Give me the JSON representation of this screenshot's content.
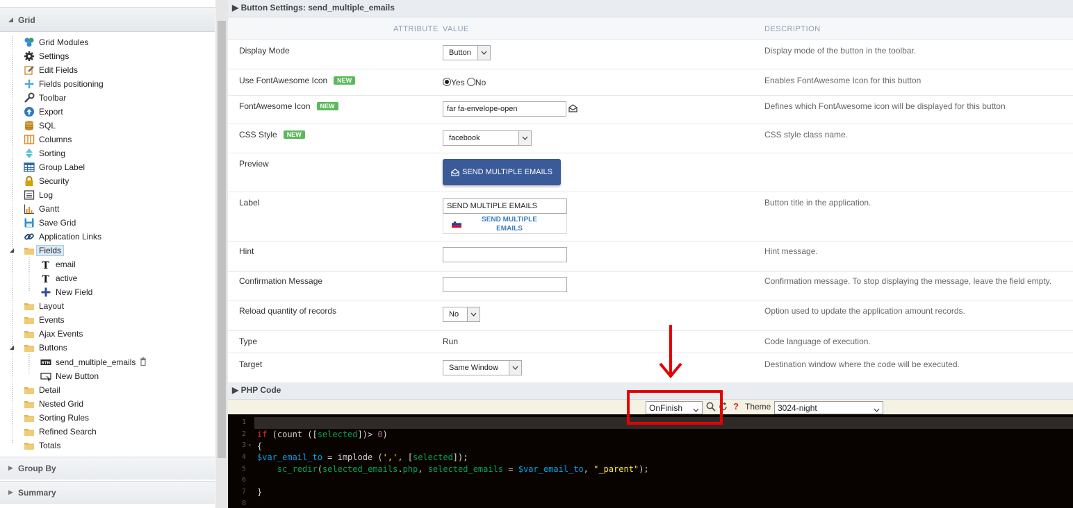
{
  "sidebar": {
    "header": "Grid",
    "items": [
      {
        "label": "Grid Modules",
        "icon": "modules-icon"
      },
      {
        "label": "Settings",
        "icon": "gear-icon"
      },
      {
        "label": "Edit Fields",
        "icon": "edit-icon"
      },
      {
        "label": "Fields positioning",
        "icon": "move-icon"
      },
      {
        "label": "Toolbar",
        "icon": "wrench-icon"
      },
      {
        "label": "Export",
        "icon": "export-icon"
      },
      {
        "label": "SQL",
        "icon": "database-icon"
      },
      {
        "label": "Columns",
        "icon": "columns-icon"
      },
      {
        "label": "Sorting",
        "icon": "sort-icon"
      },
      {
        "label": "Group Label",
        "icon": "table-icon"
      },
      {
        "label": "Security",
        "icon": "lock-icon"
      },
      {
        "label": "Log",
        "icon": "log-icon"
      },
      {
        "label": "Gantt",
        "icon": "chart-icon"
      },
      {
        "label": "Save Grid",
        "icon": "save-icon"
      },
      {
        "label": "Application Links",
        "icon": "link-icon"
      },
      {
        "label": "Fields",
        "icon": "folder-icon"
      },
      {
        "label": "email",
        "icon": "text-field-icon"
      },
      {
        "label": "active",
        "icon": "text-field-icon"
      },
      {
        "label": "New Field",
        "icon": "plus-icon"
      },
      {
        "label": "Layout",
        "icon": "folder-icon"
      },
      {
        "label": "Events",
        "icon": "folder-icon"
      },
      {
        "label": "Ajax Events",
        "icon": "folder-icon"
      },
      {
        "label": "Buttons",
        "icon": "folder-icon"
      },
      {
        "label": "send_multiple_emails",
        "icon": "button-icon"
      },
      {
        "label": "New Button",
        "icon": "new-button-icon"
      },
      {
        "label": "Detail",
        "icon": "folder-icon"
      },
      {
        "label": "Nested Grid",
        "icon": "folder-icon"
      },
      {
        "label": "Sorting Rules",
        "icon": "folder-icon"
      },
      {
        "label": "Refined Search",
        "icon": "folder-icon"
      },
      {
        "label": "Totals",
        "icon": "folder-icon"
      }
    ],
    "sections": [
      "Group By",
      "Summary"
    ]
  },
  "panel": {
    "title": "Button Settings: send_multiple_emails",
    "col_attribute": "ATTRIBUTE",
    "col_value": "VALUE",
    "col_description": "DESCRIPTION",
    "new_badge": "NEW",
    "rows": {
      "display_mode": {
        "attr": "Display Mode",
        "value": "Button",
        "desc": "Display mode of the button in the toolbar."
      },
      "fa_use": {
        "attr": "Use FontAwesome Icon",
        "yes": "Yes",
        "no": "No",
        "desc": "Enables FontAwesome Icon for this button"
      },
      "fa_icon": {
        "attr": "FontAwesome Icon",
        "value": "far fa-envelope-open",
        "desc": "Defines which FontAwesome icon will be displayed for this button"
      },
      "css_style": {
        "attr": "CSS Style",
        "value": "facebook",
        "desc": "CSS style class name."
      },
      "preview": {
        "attr": "Preview",
        "button": "SEND MULTIPLE EMAILS"
      },
      "label": {
        "attr": "Label",
        "value": "SEND MULTIPLE EMAILS",
        "lang_text": "SEND MULTIPLE EMAILS",
        "desc": "Button title in the application."
      },
      "hint": {
        "attr": "Hint",
        "value": "",
        "desc": "Hint message."
      },
      "confirm": {
        "attr": "Confirmation Message",
        "value": "",
        "desc": "Confirmation message. To stop displaying the message, leave the field empty."
      },
      "reload": {
        "attr": "Reload quantity of records",
        "value": "No",
        "desc": "Option used to update the application amount records."
      },
      "type": {
        "attr": "Type",
        "value": "Run",
        "desc": "Code language of execution."
      },
      "target": {
        "attr": "Target",
        "value": "Same Window",
        "desc": "Destination window where the code will be executed."
      }
    }
  },
  "php": {
    "title": "PHP Code",
    "event": "OnFinish",
    "theme_label": "Theme",
    "theme": "3024-night",
    "line_numbers": [
      "1",
      "2",
      "3",
      "4",
      "5",
      "6",
      "7",
      "8"
    ]
  },
  "colors": {
    "accent": "#3b5a9a",
    "badge": "#5cb85c",
    "annotation": "#e60000",
    "editor_bg": "#090300"
  }
}
